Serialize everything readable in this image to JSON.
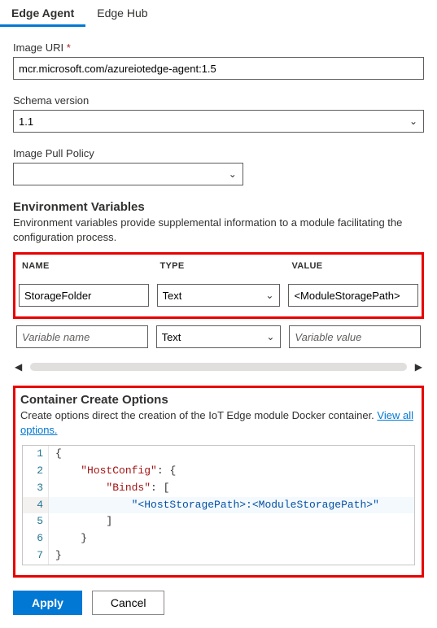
{
  "tabs": {
    "edgeAgent": "Edge Agent",
    "edgeHub": "Edge Hub"
  },
  "fields": {
    "imageUri": {
      "label": "Image URI",
      "value": "mcr.microsoft.com/azureiotedge-agent:1.5",
      "required": "*"
    },
    "schemaVersion": {
      "label": "Schema version",
      "value": "1.1"
    },
    "imagePullPolicy": {
      "label": "Image Pull Policy",
      "value": ""
    }
  },
  "envVars": {
    "title": "Environment Variables",
    "desc": "Environment variables provide supplemental information to a module facilitating the configuration process.",
    "headers": {
      "name": "NAME",
      "type": "TYPE",
      "value": "VALUE"
    },
    "row1": {
      "name": "StorageFolder",
      "type": "Text",
      "value": "<ModuleStoragePath>"
    },
    "row2": {
      "namePlaceholder": "Variable name",
      "type": "Text",
      "valuePlaceholder": "Variable value"
    }
  },
  "cco": {
    "title": "Container Create Options",
    "desc": "Create options direct the creation of the IoT Edge module Docker container. ",
    "linkText": "View all options.",
    "code": {
      "l1": "{",
      "l2": "    \"HostConfig\": {",
      "l3": "        \"Binds\": [",
      "l4": "            \"<HostStoragePath>:<ModuleStoragePath>\"",
      "l5": "        ]",
      "l6": "    }",
      "l7": "}",
      "keys": {
        "hostConfig": "\"HostConfig\"",
        "binds": "\"Binds\"",
        "bindVal": "\"<HostStoragePath>:<ModuleStoragePath>\""
      }
    }
  },
  "buttons": {
    "apply": "Apply",
    "cancel": "Cancel"
  }
}
